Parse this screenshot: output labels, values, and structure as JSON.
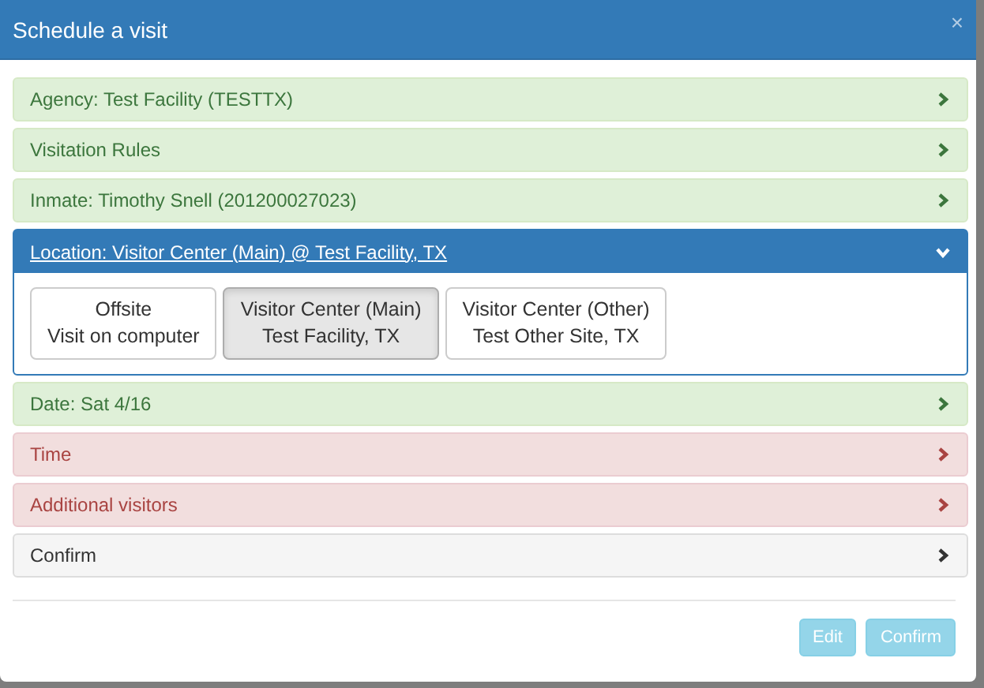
{
  "dialog": {
    "title": "Schedule a visit",
    "close": "×"
  },
  "sections": [
    {
      "label": "Agency: Test Facility (TESTTX)",
      "kind": "success",
      "expanded": false
    },
    {
      "label": "Visitation Rules",
      "kind": "success",
      "expanded": false
    },
    {
      "label": "Inmate: Timothy Snell (201200027023)",
      "kind": "success",
      "expanded": false
    },
    {
      "label": "Location: Visitor Center (Main) @ Test Facility, TX",
      "kind": "primary",
      "expanded": true,
      "options": [
        {
          "title": "Offsite",
          "subtitle": "Visit on computer",
          "selected": false
        },
        {
          "title": "Visitor Center (Main)",
          "subtitle": "Test Facility, TX",
          "selected": true
        },
        {
          "title": "Visitor Center (Other)",
          "subtitle": "Test Other Site, TX",
          "selected": false
        }
      ]
    },
    {
      "label": "Date: Sat 4/16",
      "kind": "success",
      "expanded": false
    },
    {
      "label": "Time",
      "kind": "danger",
      "expanded": false
    },
    {
      "label": "Additional visitors",
      "kind": "danger",
      "expanded": false
    },
    {
      "label": "Confirm",
      "kind": "default",
      "expanded": false
    }
  ],
  "buttons": [
    {
      "label": "Edit",
      "disabled": true
    },
    {
      "label": "Confirm",
      "disabled": true
    }
  ]
}
